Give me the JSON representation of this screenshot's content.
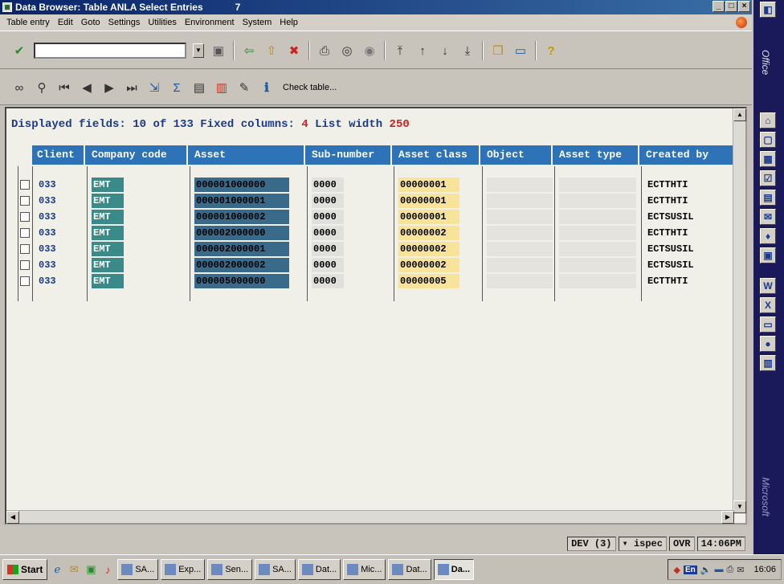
{
  "window": {
    "title": "Data Browser: Table ANLA Select Entries",
    "title_num": "7",
    "buttons": [
      "minimize",
      "maximize",
      "close"
    ]
  },
  "menu": [
    "Table entry",
    "Edit",
    "Goto",
    "Settings",
    "Utilities",
    "Environment",
    "System",
    "Help"
  ],
  "toolbar1": {
    "icons": [
      "checkmark-icon",
      "save-icon",
      "back-icon",
      "exit-icon",
      "cancel-icon",
      "print-icon",
      "find-icon",
      "find-next-icon",
      "first-page-icon",
      "prev-page-icon",
      "next-page-icon",
      "last-page-icon",
      "create-session-icon",
      "shortcut-icon",
      "help-icon"
    ]
  },
  "toolbar2": {
    "icons": [
      "glasses-icon",
      "magnifier-icon",
      "first-icon",
      "previous-icon",
      "next-icon",
      "last-icon",
      "export-icon",
      "sum-icon",
      "details-icon",
      "columns-icon",
      "edit-icon",
      "info-icon"
    ],
    "check_table": "Check table..."
  },
  "list": {
    "displayed_label": "Displayed fields:",
    "displayed_value": "10",
    "displayed_of": "of 133",
    "fixed_label": "Fixed columns:",
    "fixed_value": "4",
    "width_label": "List width",
    "width_value": "250",
    "columns": [
      "Client",
      "Company code",
      "Asset",
      "Sub-number",
      "Asset class",
      "Object",
      "Asset type",
      "Created by"
    ],
    "rows": [
      {
        "client": "033",
        "company": "EMT",
        "asset": "000001000000",
        "sub": "0000",
        "class": "00000001",
        "created_by": "ECTTHTI"
      },
      {
        "client": "033",
        "company": "EMT",
        "asset": "000001000001",
        "sub": "0000",
        "class": "00000001",
        "created_by": "ECTTHTI"
      },
      {
        "client": "033",
        "company": "EMT",
        "asset": "000001000002",
        "sub": "0000",
        "class": "00000001",
        "created_by": "ECTSUSIL"
      },
      {
        "client": "033",
        "company": "EMT",
        "asset": "000002000000",
        "sub": "0000",
        "class": "00000002",
        "created_by": "ECTTHTI"
      },
      {
        "client": "033",
        "company": "EMT",
        "asset": "000002000001",
        "sub": "0000",
        "class": "00000002",
        "created_by": "ECTSUSIL"
      },
      {
        "client": "033",
        "company": "EMT",
        "asset": "000002000002",
        "sub": "0000",
        "class": "00000002",
        "created_by": "ECTSUSIL"
      },
      {
        "client": "033",
        "company": "EMT",
        "asset": "000005000000",
        "sub": "0000",
        "class": "00000005",
        "created_by": "ECTTHTI"
      }
    ]
  },
  "status": {
    "system": "DEV",
    "session": "(3)",
    "server": "ispec",
    "mode": "OVR",
    "time": "14:06PM"
  },
  "officebar": {
    "title": "Office",
    "footer": "Microsoft"
  },
  "taskbar": {
    "start": "Start",
    "tasks": [
      "SA...",
      "Exp...",
      "Sen...",
      "SA...",
      "Dat...",
      "Mic...",
      "Dat...",
      "Da..."
    ],
    "active_index": 7,
    "lang": "En",
    "clock": "16:06"
  }
}
